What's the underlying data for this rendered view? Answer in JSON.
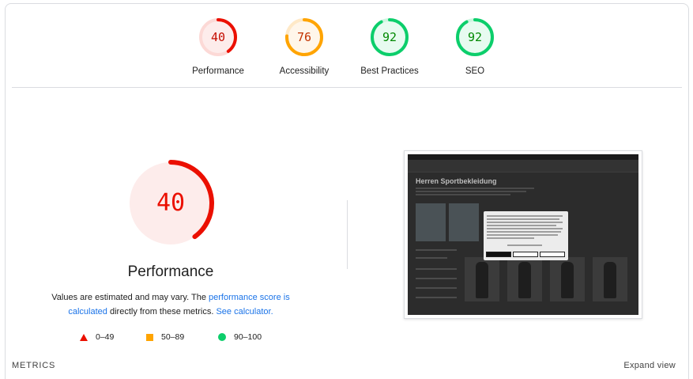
{
  "scores": [
    {
      "name": "performance",
      "label": "Performance",
      "value": "40",
      "fraction": 0.4,
      "color": "#eb0f00",
      "bg": "#fdeceb",
      "track": "#fcd9d6"
    },
    {
      "name": "accessibility",
      "label": "Accessibility",
      "value": "76",
      "fraction": 0.76,
      "color": "#ffa400",
      "bg": "#fff6ea",
      "track": "#ffe9c7"
    },
    {
      "name": "best-practices",
      "label": "Best Practices",
      "value": "92",
      "fraction": 0.92,
      "color": "#0cce6b",
      "bg": "#e7fbf0",
      "track": "#ccf6df"
    },
    {
      "name": "seo",
      "label": "SEO",
      "value": "92",
      "fraction": 0.92,
      "color": "#0cce6b",
      "bg": "#e7fbf0",
      "track": "#ccf6df"
    }
  ],
  "main": {
    "score": "40",
    "fraction": 0.4,
    "title": "Performance",
    "desc_prefix": "Values are estimated and may vary. The ",
    "link_score": "performance score is calculated",
    "desc_middle": " directly from these metrics. ",
    "link_calc": "See calculator.",
    "color": "#eb0f00",
    "bg": "#fdeceb"
  },
  "legend": {
    "fail": "0–49",
    "average": "50–89",
    "pass": "90–100"
  },
  "metrics": {
    "title": "METRICS",
    "expand": "Expand view"
  },
  "thumbnail": {
    "heading": "Herren Sportbekleidung"
  }
}
